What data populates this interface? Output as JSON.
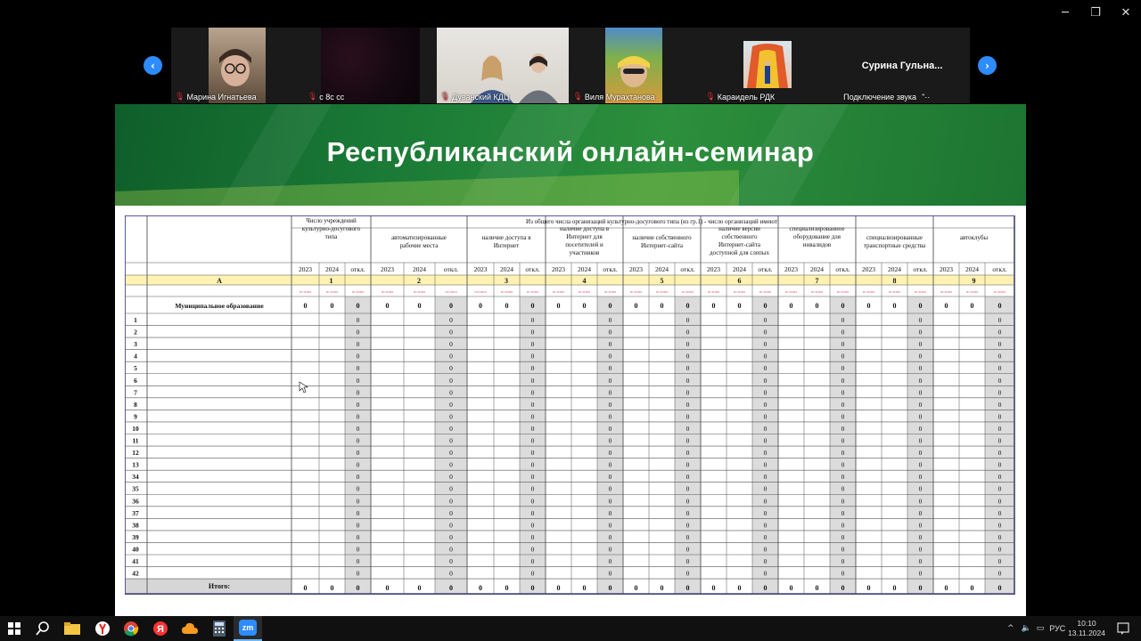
{
  "window": {
    "minimize": "─",
    "restore": "❐",
    "close": "✕"
  },
  "participants": [
    {
      "name": "Марина Игнатьева",
      "muted": true
    },
    {
      "name": "с 8с сс",
      "muted": true
    },
    {
      "name": "Дуванский КДЦ",
      "muted": true
    },
    {
      "name": "Виля Мурахтанова",
      "muted": true
    },
    {
      "name": "Караидель РДК",
      "muted": true
    },
    {
      "name": "Подключение звука",
      "display_name": "Сурина Гульна...",
      "muted": false
    }
  ],
  "slide": {
    "title": "Республиканский онлайн-семинар"
  },
  "table": {
    "group_header": "Из общего числа организаций культурно-досугового типа (из гр.1) - число организаций имеют:",
    "first_col_header": "Число учреждений культурно-досугового типа",
    "col_a": "А",
    "col_headers": [
      "автоматизированные рабочие места",
      "наличие доступа в Интернет",
      "наличие доступа в Интернет для посетителей и участников",
      "наличие собственного Интернет-сайта",
      "наличие версии собственного Интернет-сайта доступной для слепых",
      "специализированное оборудование для инвалидов",
      "специализированные транспортные средства",
      "автоклубы"
    ],
    "group_numbers": [
      "1",
      "2",
      "3",
      "4",
      "5",
      "6",
      "7",
      "8",
      "9"
    ],
    "sub_headers": [
      "2023",
      "2024",
      "откл."
    ],
    "check_label": "истина",
    "municipal_label": "Муниципальное образование",
    "row_numbers": [
      "1",
      "2",
      "3",
      "4",
      "5",
      "6",
      "7",
      "8",
      "9",
      "10",
      "11",
      "12",
      "13",
      "34",
      "35",
      "36",
      "37",
      "38",
      "39",
      "40",
      "41",
      "42"
    ],
    "zero": "0",
    "total_label": "Итого:"
  },
  "taskbar": {
    "icons": [
      "windows-start",
      "search",
      "file-explorer",
      "yandex-browser",
      "chrome",
      "yandex",
      "cloud-app",
      "calculator",
      "zoom"
    ],
    "zoom_label": "zm",
    "lang": "РУС",
    "time": "10:10",
    "date": "13.11.2024"
  },
  "colors": {
    "banner": "#1a7a36",
    "zoom_blue": "#2d8cff",
    "header_yellow": "#fff2b3",
    "shaded_cell": "#dcdcdc",
    "mic_muted": "#e0383e"
  }
}
